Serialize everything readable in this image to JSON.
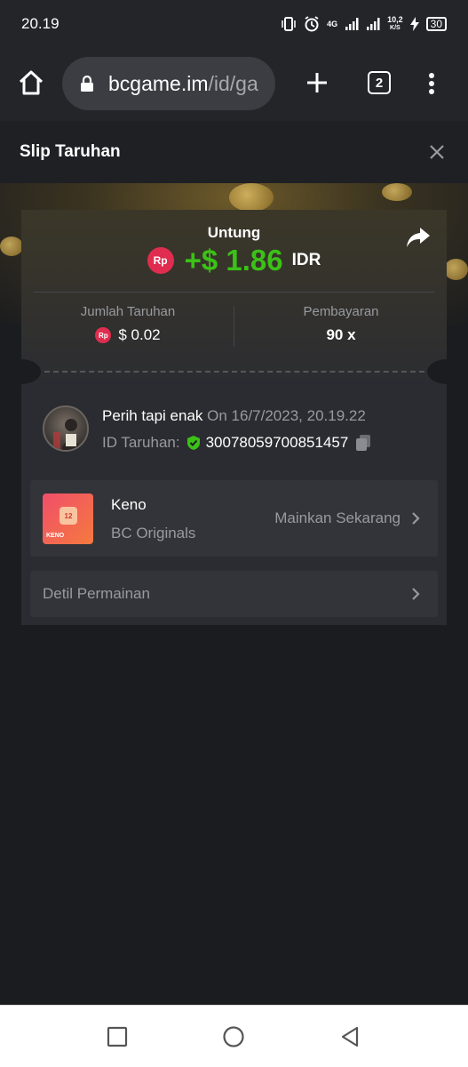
{
  "status_bar": {
    "time": "20.19",
    "network_label": "4G",
    "speed": "10,2",
    "speed_unit": "K/S",
    "battery": "30"
  },
  "browser": {
    "url_host": "bcgame.im",
    "url_path": "/id/ga",
    "tab_count": "2"
  },
  "header": {
    "title": "Slip Taruhan"
  },
  "bet": {
    "profit_label": "Untung",
    "currency_badge": "Rp",
    "profit_value": "+$ 1.86",
    "profit_currency": "IDR",
    "amount_label": "Jumlah Taruhan",
    "amount_value": "$ 0.02",
    "payout_label": "Pembayaran",
    "payout_value": "90 x"
  },
  "user": {
    "name": "Perih tapi enak",
    "date_text": "On 16/7/2023, 20.19.22",
    "bet_id_label": "ID Taruhan:",
    "bet_id": "30078059700851457"
  },
  "game": {
    "thumb_number": "12",
    "thumb_label": "KENO",
    "name": "Keno",
    "provider": "BC Originals",
    "play_label": "Mainkan Sekarang"
  },
  "details": {
    "label": "Detil Permainan"
  },
  "colors": {
    "profit_green": "#3bc117",
    "badge_red": "#e02d4f",
    "verified_green": "#3bc117"
  }
}
